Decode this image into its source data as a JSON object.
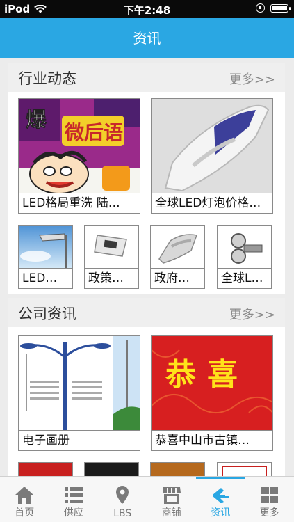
{
  "status_bar": {
    "carrier": "iPod",
    "time": "下午2:48"
  },
  "header": {
    "title": "资讯"
  },
  "sections": [
    {
      "title": "行业动态",
      "more": "更多>>",
      "featured": [
        {
          "caption": "LED格局重洗 陆…",
          "image_text_large": "爆",
          "image_text_title": "微后语"
        },
        {
          "caption": "全球LED灯泡价格…"
        }
      ],
      "small": [
        {
          "caption": "LED…"
        },
        {
          "caption": "政策…"
        },
        {
          "caption": "政府…"
        },
        {
          "caption": "全球L…"
        }
      ]
    },
    {
      "title": "公司资讯",
      "more": "更多>>",
      "featured": [
        {
          "caption": "电子画册"
        },
        {
          "caption": "恭喜中山市古镇…",
          "image_text": "恭喜"
        }
      ]
    }
  ],
  "tabbar": {
    "active_index": 4,
    "accent": "#2aa7e3",
    "tabs": [
      {
        "label": "首页",
        "icon": "home-icon"
      },
      {
        "label": "供应",
        "icon": "list-icon"
      },
      {
        "label": "LBS",
        "icon": "location-pin-icon"
      },
      {
        "label": "商铺",
        "icon": "shop-icon"
      },
      {
        "label": "资讯",
        "icon": "news-icon"
      },
      {
        "label": "更多",
        "icon": "grid-icon"
      }
    ]
  }
}
